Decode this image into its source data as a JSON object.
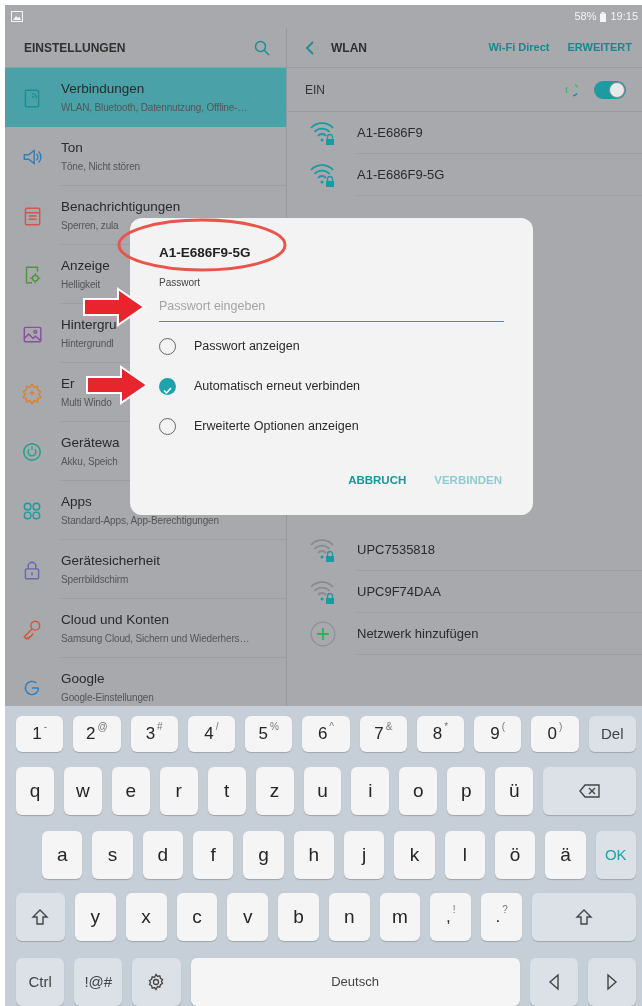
{
  "status_bar": {
    "battery": "58%",
    "time": "19:15"
  },
  "sidebar": {
    "title": "EINSTELLUNGEN",
    "items": [
      {
        "kind": "connections",
        "title": "Verbindungen",
        "subtitle": "WLAN, Bluetooth, Datennutzung, Offline-…",
        "selected": true
      },
      {
        "kind": "sound",
        "title": "Ton",
        "subtitle": "Töne, Nicht stören",
        "selected": false
      },
      {
        "kind": "notifications",
        "title": "Benachrichtigungen",
        "subtitle": "Sperren, zula",
        "selected": false
      },
      {
        "kind": "display",
        "title": "Anzeige",
        "subtitle": "Helligkeit",
        "selected": false
      },
      {
        "kind": "wallpaper",
        "title": "Hintergru",
        "subtitle": "Hintergrundl",
        "selected": false
      },
      {
        "kind": "advanced",
        "title": "Er",
        "subtitle": "Multi Windo",
        "selected": false
      },
      {
        "kind": "maintenance",
        "title": "Gerätewa",
        "subtitle": "Akku, Speich",
        "selected": false
      },
      {
        "kind": "apps",
        "title": "Apps",
        "subtitle": "Standard-Apps, App-Berechtigungen",
        "selected": false
      },
      {
        "kind": "security",
        "title": "Gerätesicherheit",
        "subtitle": "Sperrbildschirm",
        "selected": false
      },
      {
        "kind": "accounts",
        "title": "Cloud und Konten",
        "subtitle": "Samsung Cloud, Sichern und Wiederhers…",
        "selected": false
      },
      {
        "kind": "google",
        "title": "Google",
        "subtitle": "Google-Einstellungen",
        "selected": false
      }
    ]
  },
  "wlan": {
    "title": "WLAN",
    "actions": [
      "Wi-Fi Direct",
      "ERWEITERT"
    ],
    "switch": {
      "label": "EIN",
      "on": true
    },
    "networks": [
      {
        "kind": "strong",
        "name": "A1-E686F9"
      },
      {
        "kind": "strong",
        "name": "A1-E686F9-5G"
      }
    ],
    "more_networks": [
      {
        "kind": "weak",
        "name": "UPC7535818"
      },
      {
        "kind": "weak",
        "name": "UPC9F74DAA"
      },
      {
        "kind": "add",
        "name": "Netzwerk hinzufügen"
      }
    ]
  },
  "dialog": {
    "title": "A1-E686F9-5G",
    "password": {
      "label": "Passwort",
      "placeholder": "Passwort eingeben"
    },
    "options": [
      {
        "label": "Passwort anzeigen",
        "checked": false
      },
      {
        "label": "Automatisch erneut verbinden",
        "checked": true
      },
      {
        "label": "Erweiterte Optionen anzeigen",
        "checked": false
      }
    ],
    "buttons": [
      {
        "label": "ABBRUCH",
        "disabled": false
      },
      {
        "label": "VERBINDEN",
        "disabled": true
      }
    ]
  },
  "keyboard": {
    "rows": [
      {
        "keys": [
          {
            "kind": "digit",
            "label": "1",
            "alt": "-"
          },
          {
            "kind": "digit",
            "label": "2",
            "alt": "@"
          },
          {
            "kind": "digit",
            "label": "3",
            "alt": "#"
          },
          {
            "kind": "digit",
            "label": "4",
            "alt": "/"
          },
          {
            "kind": "digit",
            "label": "5",
            "alt": "%"
          },
          {
            "kind": "digit",
            "label": "6",
            "alt": "^"
          },
          {
            "kind": "digit",
            "label": "7",
            "alt": "&"
          },
          {
            "kind": "digit",
            "label": "8",
            "alt": "*"
          },
          {
            "kind": "digit",
            "label": "9",
            "alt": "("
          },
          {
            "kind": "digit",
            "label": "0",
            "alt": ")"
          },
          {
            "kind": "action",
            "label": "Del"
          }
        ]
      },
      {
        "keys": [
          {
            "kind": "letter",
            "label": "q"
          },
          {
            "kind": "letter",
            "label": "w"
          },
          {
            "kind": "letter",
            "label": "e"
          },
          {
            "kind": "letter",
            "label": "r"
          },
          {
            "kind": "letter",
            "label": "t"
          },
          {
            "kind": "letter",
            "label": "z"
          },
          {
            "kind": "letter",
            "label": "u"
          },
          {
            "kind": "letter",
            "label": "i"
          },
          {
            "kind": "letter",
            "label": "o"
          },
          {
            "kind": "letter",
            "label": "p"
          },
          {
            "kind": "letter",
            "label": "ü"
          },
          {
            "kind": "backspace"
          }
        ]
      },
      {
        "keys": [
          {
            "kind": "letter",
            "label": "a"
          },
          {
            "kind": "letter",
            "label": "s"
          },
          {
            "kind": "letter",
            "label": "d"
          },
          {
            "kind": "letter",
            "label": "f"
          },
          {
            "kind": "letter",
            "label": "g"
          },
          {
            "kind": "letter",
            "label": "h"
          },
          {
            "kind": "letter",
            "label": "j"
          },
          {
            "kind": "letter",
            "label": "k"
          },
          {
            "kind": "letter",
            "label": "l"
          },
          {
            "kind": "letter",
            "label": "ö"
          },
          {
            "kind": "letter",
            "label": "ä"
          },
          {
            "kind": "enter",
            "label": "OK"
          }
        ]
      },
      {
        "keys": [
          {
            "kind": "shift"
          },
          {
            "kind": "letter",
            "label": "y"
          },
          {
            "kind": "letter",
            "label": "x"
          },
          {
            "kind": "letter",
            "label": "c"
          },
          {
            "kind": "letter",
            "label": "v"
          },
          {
            "kind": "letter",
            "label": "b"
          },
          {
            "kind": "letter",
            "label": "n"
          },
          {
            "kind": "letter",
            "label": "m"
          },
          {
            "kind": "digit",
            "label": ",",
            "alt": "!"
          },
          {
            "kind": "digit",
            "label": ".",
            "alt": "?"
          },
          {
            "kind": "shift"
          }
        ]
      },
      {
        "keys": [
          {
            "kind": "action",
            "label": "Ctrl"
          },
          {
            "kind": "action",
            "label": "!@#"
          },
          {
            "kind": "settings"
          },
          {
            "kind": "space",
            "label": "Deutsch"
          },
          {
            "kind": "left"
          },
          {
            "kind": "right"
          }
        ]
      }
    ]
  }
}
